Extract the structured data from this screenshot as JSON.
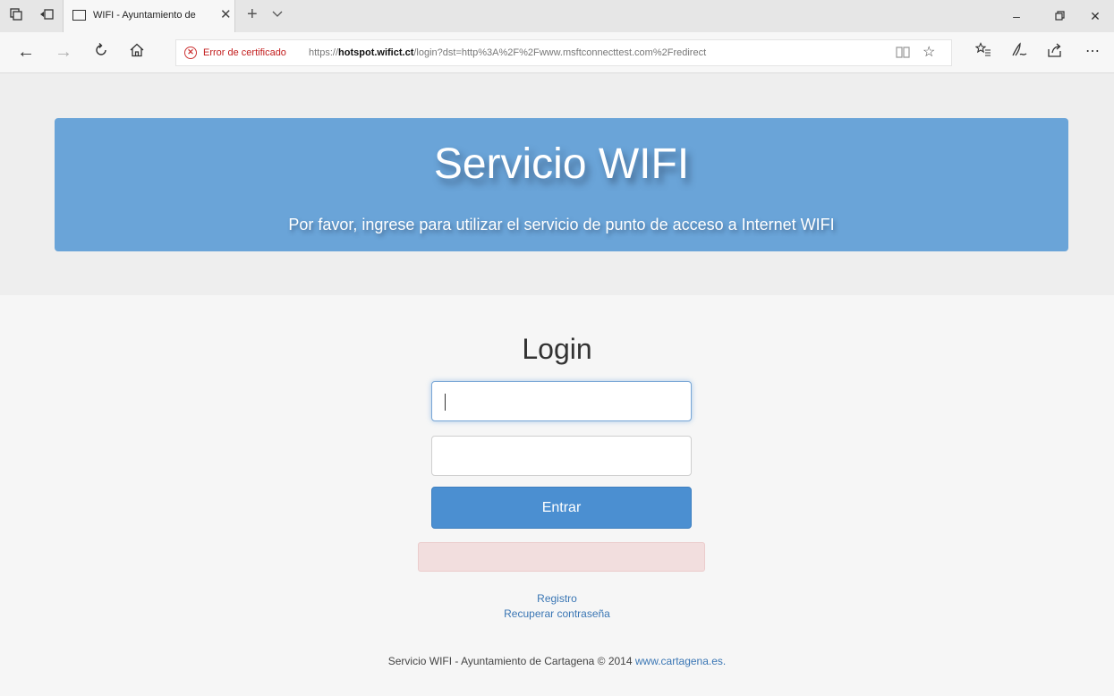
{
  "browser": {
    "tab_title": "WIFI - Ayuntamiento de",
    "address": {
      "cert_error": "Error de certificado",
      "url_prefix": "https://",
      "url_host": "hotspot.wifict.ct",
      "url_rest": "/login?dst=http%3A%2F%2Fwww.msftconnecttest.com%2Fredirect"
    },
    "icons": {
      "back": "back-icon",
      "forward": "forward-icon",
      "refresh": "refresh-icon",
      "home": "home-icon",
      "reading": "reading-view-icon",
      "favorite": "favorite-star-icon",
      "favorites_hub": "favorites-hub-icon",
      "notes": "web-note-icon",
      "share": "share-icon",
      "more": "more-icon"
    }
  },
  "hero": {
    "title": "Servicio WIFI",
    "subtitle": "Por favor, ingrese para utilizar el servicio de punto de acceso a Internet WIFI",
    "color": "#6aa4d8"
  },
  "login": {
    "title": "Login",
    "username_value": "",
    "password_value": "",
    "submit_label": "Entrar",
    "accent": "#4b8fd1"
  },
  "links": {
    "register": "Registro",
    "recover": "Recuperar contraseña"
  },
  "footer": {
    "text": "Servicio WIFI - Ayuntamiento de Cartagena © 2014",
    "link": "www.cartagena.es."
  }
}
